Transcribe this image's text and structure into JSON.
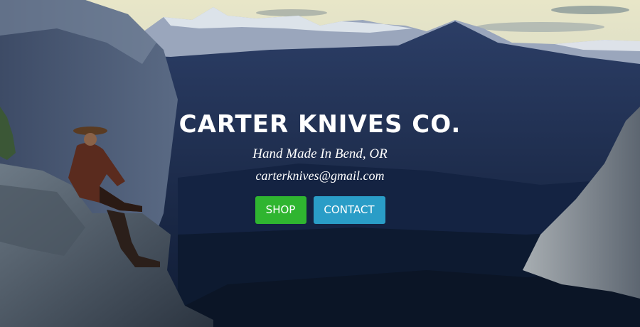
{
  "hero": {
    "title": "CARTER KNIVES CO.",
    "tagline": "Hand Made In Bend, OR",
    "email": "carterknives@gmail.com"
  },
  "buttons": {
    "shop_label": "SHOP",
    "contact_label": "CONTACT"
  },
  "colors": {
    "shop": "#2fb530",
    "contact": "#2a9dc7"
  }
}
